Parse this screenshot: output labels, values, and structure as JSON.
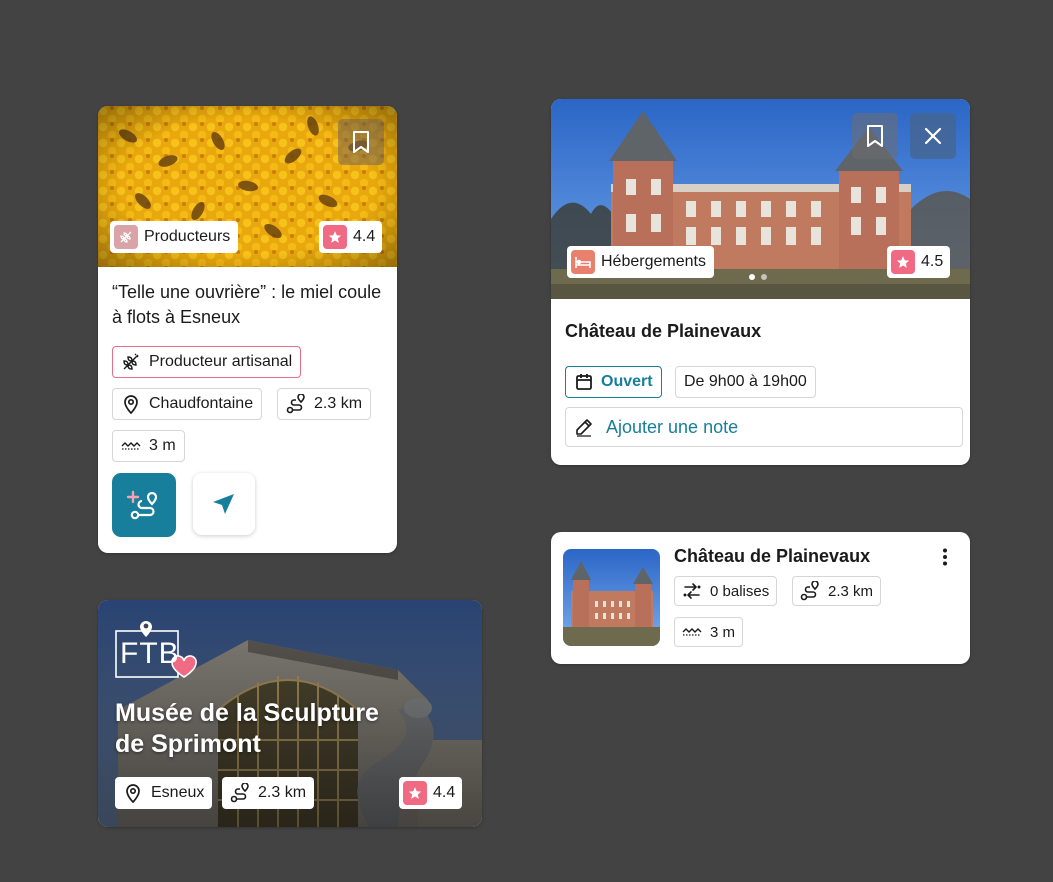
{
  "cards": {
    "honey": {
      "category": "Producteurs",
      "rating": "4.4",
      "title": "“Telle une ouvrière” : le miel coule à flots à Esneux",
      "tag": "Producteur artisanal",
      "location": "Chaudfontaine",
      "distance": "2.3 km",
      "elevation": "3 m"
    },
    "chateau": {
      "category": "Hébergements",
      "rating": "4.5",
      "title": "Château de Plainevaux",
      "status": "Ouvert",
      "hours": "De 9h00 à 19h00",
      "note_label": "Ajouter une note"
    },
    "museum": {
      "logo_text": "FTB",
      "title_line1": "Musée de la Sculpture",
      "title_line2": "de Sprimont",
      "location": "Esneux",
      "distance": "2.3 km",
      "rating": "4.4"
    },
    "route": {
      "title": "Château de Plainevaux",
      "markers": "0 balises",
      "distance": "2.3 km",
      "elevation": "3 m"
    }
  },
  "icons": [
    "bookmark-icon",
    "close-icon",
    "star-icon",
    "wheat-icon",
    "bed-icon",
    "map-pin-icon",
    "route-icon",
    "elevation-icon",
    "calendar-icon",
    "pencil-icon",
    "add-route-icon",
    "navigation-arrow-icon",
    "more-vertical-icon",
    "markers-icon",
    "heart-icon"
  ],
  "colors": {
    "background": "#434343",
    "teal": "#177e9b",
    "pink": "#ef6a82",
    "producer_badge": "#d9a3a7",
    "lodging_badge": "#e8806e",
    "tag_border": "#e46f86"
  }
}
